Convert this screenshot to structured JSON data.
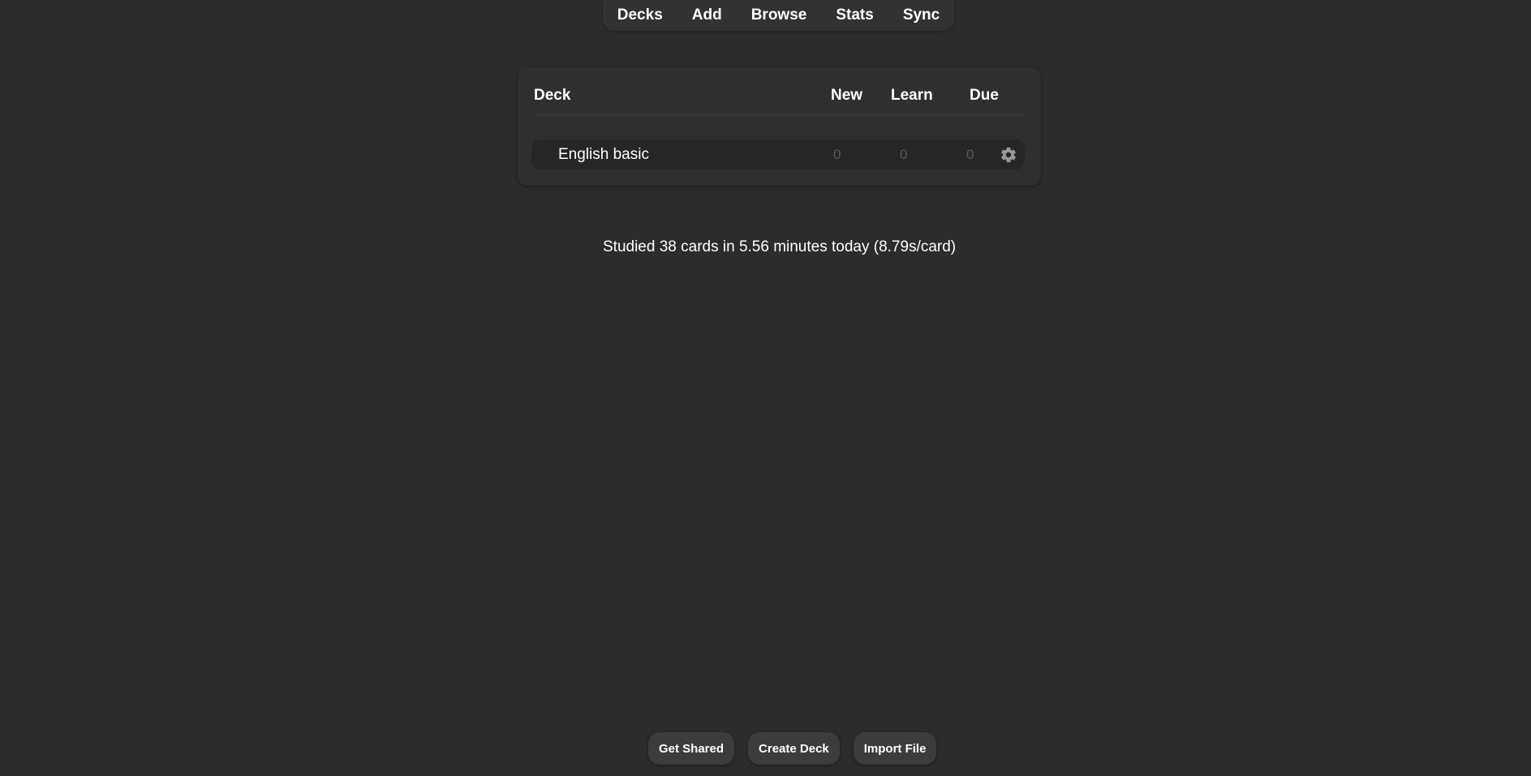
{
  "nav": {
    "items": [
      "Decks",
      "Add",
      "Browse",
      "Stats",
      "Sync"
    ]
  },
  "deck_table": {
    "headers": {
      "deck": "Deck",
      "new": "New",
      "learn": "Learn",
      "due": "Due"
    },
    "rows": [
      {
        "name": "English basic",
        "new": "0",
        "learn": "0",
        "due": "0",
        "options_icon": "gear-icon"
      }
    ]
  },
  "studied_summary": "Studied 38 cards in 5.56 minutes today (8.79s/card)",
  "bottom_buttons": {
    "get_shared": "Get Shared",
    "create_deck": "Create Deck",
    "import_file": "Import File"
  },
  "colors": {
    "background": "#2c2c2c",
    "panel": "#2f2f2f",
    "row": "#262626",
    "button": "#3c3c3c",
    "muted_count": "#5a5a5a"
  }
}
